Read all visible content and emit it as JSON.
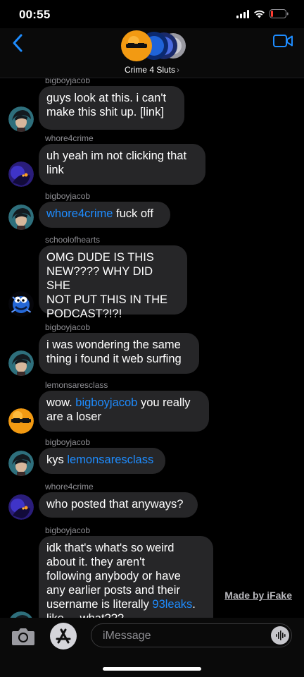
{
  "status_bar": {
    "time": "00:55"
  },
  "header": {
    "group_name": "Crime 4 Sluts",
    "chevron": "›"
  },
  "messages": [
    {
      "sender": "bigboyjacob",
      "avatar": "jacob",
      "lines": [
        [
          {
            "t": "guys look at this. i can't"
          }
        ],
        [
          {
            "t": "make this shit up. [link]"
          }
        ]
      ]
    },
    {
      "sender": "whore4crime",
      "avatar": "whore",
      "lines": [
        [
          {
            "t": "uh yeah im not clicking that"
          }
        ],
        [
          {
            "t": "link"
          }
        ]
      ]
    },
    {
      "sender": "bigboyjacob",
      "avatar": "jacob",
      "lines": [
        [
          {
            "t": "whore4crime",
            "m": true
          },
          {
            "t": " fuck off"
          }
        ]
      ]
    },
    {
      "sender": "schoolofhearts",
      "avatar": "cookie",
      "lines": [
        [
          {
            "t": "OMG DUDE IS THIS"
          }
        ],
        [
          {
            "t": "NEW???? WHY DID SHE"
          }
        ],
        [
          {
            "t": "NOT PUT THIS IN THE"
          }
        ],
        [
          {
            "t": "PODCAST?!?!"
          }
        ]
      ]
    },
    {
      "sender": "bigboyjacob",
      "avatar": "jacob",
      "lines": [
        [
          {
            "t": "i was wondering the same"
          }
        ],
        [
          {
            "t": "thing i found it web surfing"
          }
        ]
      ]
    },
    {
      "sender": "lemonsaresclass",
      "avatar": "lemon",
      "lines": [
        [
          {
            "t": "wow. "
          },
          {
            "t": "bigboyjacob",
            "m": true
          },
          {
            "t": " you really"
          }
        ],
        [
          {
            "t": "are a loser"
          }
        ]
      ]
    },
    {
      "sender": "bigboyjacob",
      "avatar": "jacob",
      "lines": [
        [
          {
            "t": "kys "
          },
          {
            "t": "lemonsaresclass",
            "m": true
          }
        ]
      ]
    },
    {
      "sender": "whore4crime",
      "avatar": "whore",
      "lines": [
        [
          {
            "t": "who posted that anyways?"
          }
        ]
      ]
    },
    {
      "sender": "bigboyjacob",
      "avatar": "jacob",
      "lines": [
        [
          {
            "t": "idk that's what's so weird"
          }
        ],
        [
          {
            "t": "about it. they aren't"
          }
        ],
        [
          {
            "t": "following anybody or have"
          }
        ],
        [
          {
            "t": "any earlier posts and their"
          }
        ],
        [
          {
            "t": "username is literally "
          },
          {
            "t": "93leaks",
            "m": true
          },
          {
            "t": "."
          }
        ],
        [
          {
            "t": "like ... what???"
          }
        ]
      ]
    }
  ],
  "watermark": "Made by iFake",
  "compose": {
    "placeholder": "iMessage"
  },
  "icons": [
    "signal-icon",
    "wifi-icon",
    "battery-icon",
    "back-chevron-icon",
    "video-call-icon",
    "camera-icon",
    "app-store-icon",
    "audio-waveform-icon"
  ],
  "colors": {
    "accent": "#1e8cff",
    "bubble": "#262628",
    "background": "#000000"
  }
}
